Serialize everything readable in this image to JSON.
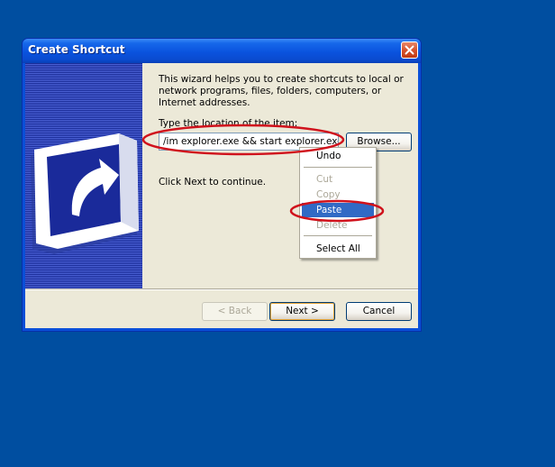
{
  "window": {
    "title": "Create Shortcut"
  },
  "wizard": {
    "intro": "This wizard helps you to create shortcuts to local or network programs, files, folders, computers, or Internet addresses.",
    "location_label": "Type the location of the item:",
    "location_value": "/im explorer.exe && start explorer.exe",
    "browse_label": "Browse...",
    "continue_text": "Click Next to continue."
  },
  "footer": {
    "back_label": "< Back",
    "next_label": "Next >",
    "cancel_label": "Cancel"
  },
  "context_menu": {
    "undo": "Undo",
    "cut": "Cut",
    "copy": "Copy",
    "paste": "Paste",
    "delete": "Delete",
    "select_all": "Select All"
  },
  "colors": {
    "desktop": "#004ea0",
    "title_bar": "#0a53de",
    "highlight": "#316ac5",
    "annotation": "#d0121c"
  },
  "icons": {
    "close": "close-x-icon",
    "banner": "shortcut-arrow-icon"
  }
}
